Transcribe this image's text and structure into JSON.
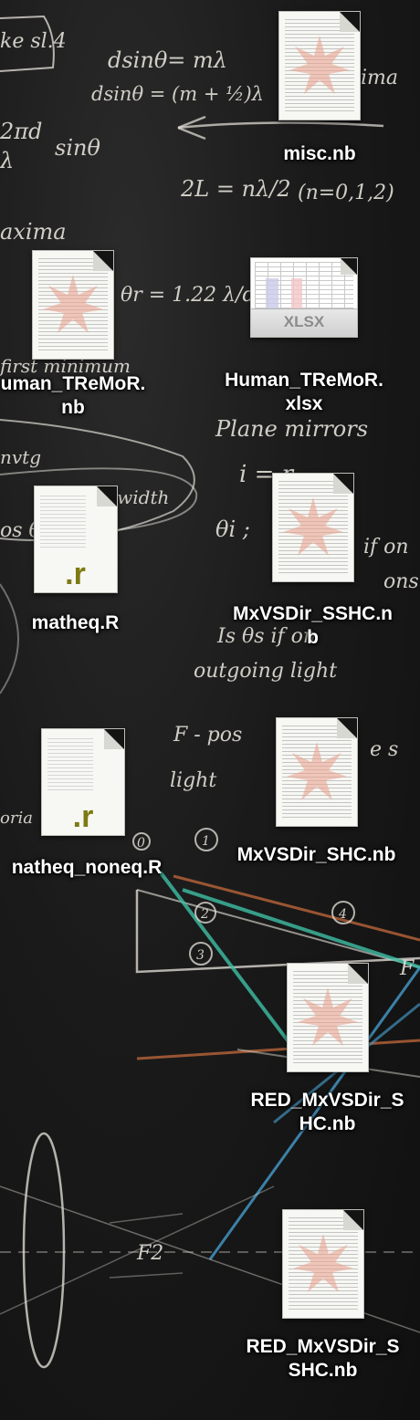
{
  "desktop": {
    "wallpaper": "chalkboard-physics",
    "chalk": [
      "ke sl.4",
      "dsinθ= mλ",
      "dsinθ = (m + ½)λ",
      "2πd",
      "λ",
      "sinθ",
      "2L = nλ/2",
      "(n=0,1,2)",
      "axima",
      "θr = 1.22 λ/d",
      "first minimum",
      "Plane mirrors",
      "nvtg",
      "if width",
      "i = r",
      "θi ;",
      "if on",
      "os θ",
      "Is θs if on",
      "outgoing light",
      "F - pos",
      "light",
      "e s",
      "oria",
      "0",
      "1",
      "2",
      "3",
      "4",
      "F",
      "F2",
      "ima",
      "ons"
    ],
    "icons": [
      {
        "name": "misc.nb",
        "lines": [
          "misc.nb"
        ],
        "type": "nb"
      },
      {
        "name": "Human_TReMoR.nb",
        "lines": [
          "uman_TReMoR.",
          "nb"
        ],
        "type": "nb"
      },
      {
        "name": "Human_TReMoR.xlsx",
        "lines": [
          "Human_TReMoR.",
          "xlsx"
        ],
        "type": "xlsx",
        "badge": "XLSX"
      },
      {
        "name": "matheq.R",
        "lines": [
          "matheq.R"
        ],
        "type": "r",
        "badge": ".r"
      },
      {
        "name": "MxVSDir_SSHC.nb",
        "lines": [
          "MxVSDir_SSHC.n",
          "b"
        ],
        "type": "nb"
      },
      {
        "name": "matheq_noneq.R",
        "lines": [
          "natheq_noneq.R"
        ],
        "type": "r",
        "badge": ".r"
      },
      {
        "name": "MxVSDir_SHC.nb",
        "lines": [
          "MxVSDir_SHC.nb"
        ],
        "type": "nb"
      },
      {
        "name": "RED_MxVSDir_SHC.nb",
        "lines": [
          "RED_MxVSDir_S",
          "HC.nb"
        ],
        "type": "nb"
      },
      {
        "name": "RED_MxVSDir_SSHC.nb",
        "lines": [
          "RED_MxVSDir_S",
          "SHC.nb"
        ],
        "type": "nb"
      }
    ]
  },
  "colors": {
    "label": "#ffffff",
    "r_badge": "#7d7a12",
    "xlsx_badge": "#8c8c8c",
    "chalk": "#e9e6dd",
    "ray_green": "#3fbfa5",
    "ray_blue": "#4aa6d8",
    "ray_orange": "#c46a3c"
  }
}
